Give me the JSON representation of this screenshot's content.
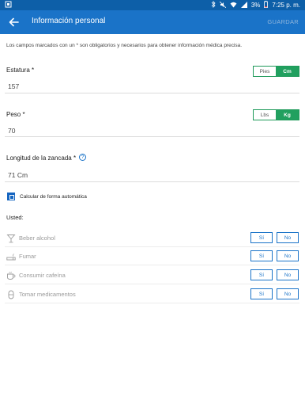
{
  "status_bar": {
    "carrier_icon": "sim-icon",
    "battery_text": "3%",
    "time": "7:25 p. m."
  },
  "app_bar": {
    "title": "Información personal",
    "save_label": "GUARDAR"
  },
  "note": "Los campos marcados con un * son obligatorios y necesarios para obtener información médica precisa.",
  "height": {
    "label": "Estatura *",
    "value": "157",
    "units": [
      "Pies",
      "Cm"
    ],
    "selected_unit": "Cm"
  },
  "weight": {
    "label": "Peso *",
    "value": "70",
    "units": [
      "Lbs",
      "Kg"
    ],
    "selected_unit": "Kg"
  },
  "stride": {
    "label": "Longitud de la zancada *",
    "help": "?",
    "value": "71 Cm",
    "auto_label": "Calcular de forma automática",
    "auto_checked": true
  },
  "habits": {
    "heading": "Usted:",
    "yes_label": "Sí",
    "no_label": "No",
    "items": [
      {
        "label": "Beber alcohol",
        "icon": "cocktail-icon"
      },
      {
        "label": "Fumar",
        "icon": "cigarette-icon"
      },
      {
        "label": "Consumir cafeína",
        "icon": "coffee-cup-icon"
      },
      {
        "label": "Tomar medicamentos",
        "icon": "pill-icon"
      }
    ]
  },
  "colors": {
    "app_bar": "#1a73c8",
    "status_bar": "#0d5fa8",
    "selected_unit": "#21a05f",
    "button_outline": "#1a73c8"
  }
}
